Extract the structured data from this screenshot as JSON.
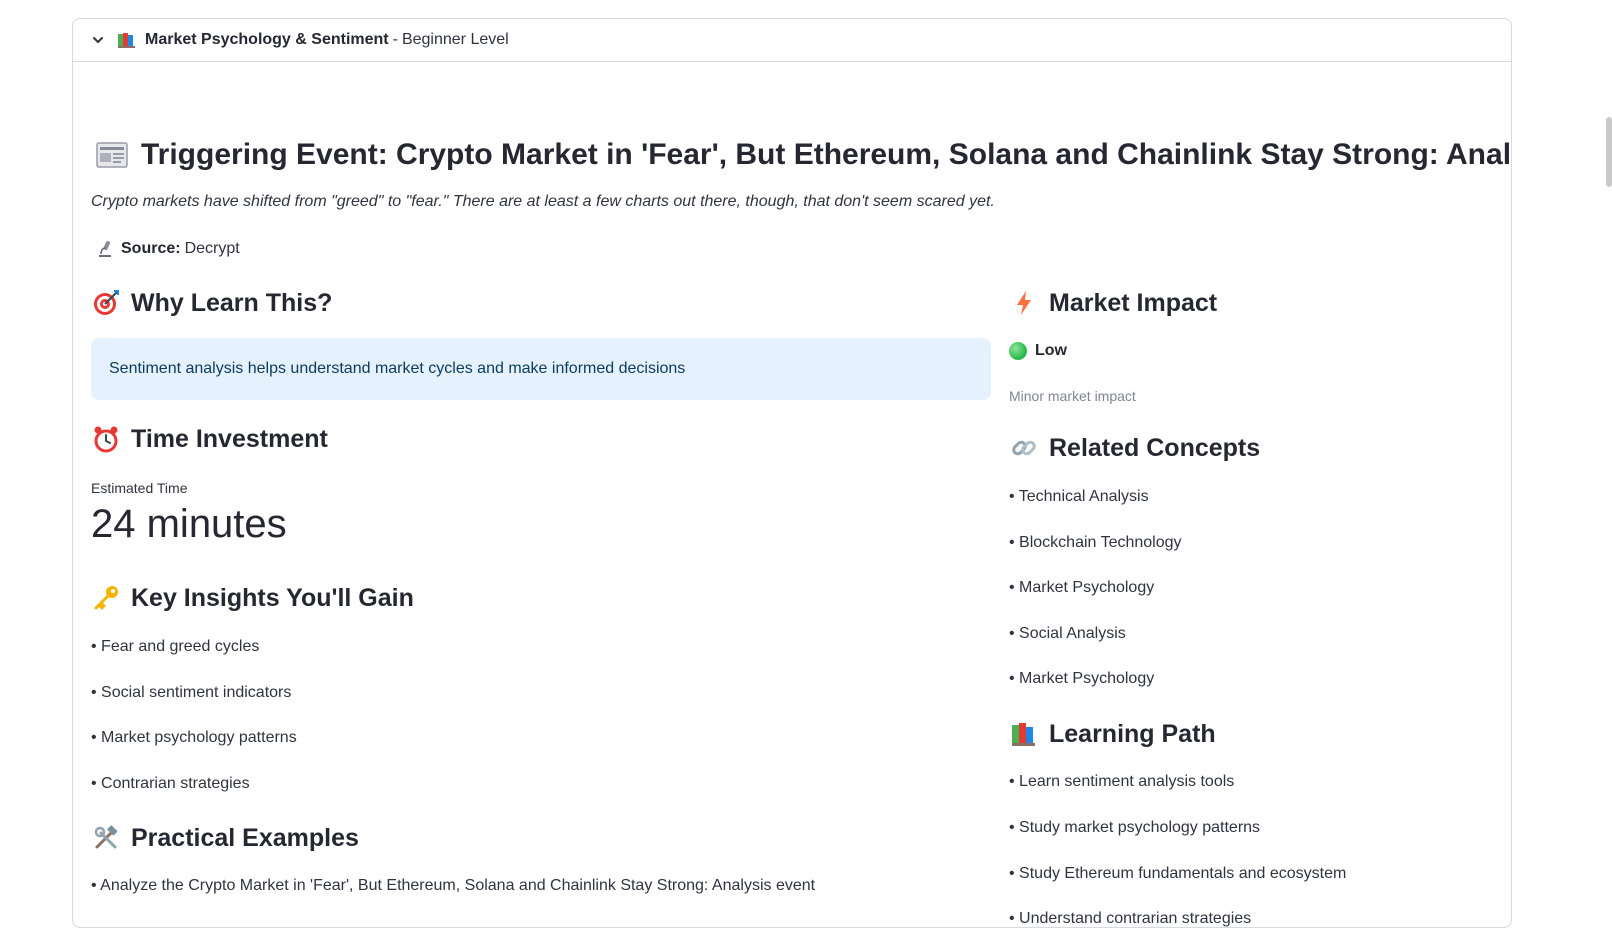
{
  "expander": {
    "title": "Market Psychology & Sentiment",
    "separator": "-",
    "level": "Beginner Level",
    "icon": "books-icon"
  },
  "event": {
    "heading": "Triggering Event: Crypto Market in 'Fear', But Ethereum, Solana and Chainlink Stay Strong: Analysis",
    "summary": "Crypto markets have shifted from \"greed\" to \"fear.\" There are at least a few charts out there, though, that don't seem scared yet.",
    "source_label": "Source:",
    "source_value": "Decrypt"
  },
  "why": {
    "heading": "Why Learn This?",
    "text": "Sentiment analysis helps understand market cycles and make informed decisions"
  },
  "time": {
    "heading": "Time Investment",
    "label": "Estimated Time",
    "value": "24 minutes"
  },
  "insights": {
    "heading": "Key Insights You'll Gain",
    "items": [
      "• Fear and greed cycles",
      "• Social sentiment indicators",
      "• Market psychology patterns",
      "• Contrarian strategies"
    ]
  },
  "examples": {
    "heading": "Practical Examples",
    "items": [
      "• Analyze the Crypto Market in 'Fear', But Ethereum, Solana and Chainlink Stay Strong: Analysis event"
    ]
  },
  "impact": {
    "heading": "Market Impact",
    "level": "Low",
    "caption": "Minor market impact"
  },
  "related": {
    "heading": "Related Concepts",
    "items": [
      "• Technical Analysis",
      "• Blockchain Technology",
      "• Market Psychology",
      "• Social Analysis",
      "• Market Psychology"
    ]
  },
  "path": {
    "heading": "Learning Path",
    "items": [
      "• Learn sentiment analysis tools",
      "• Study market psychology patterns",
      "• Study Ethereum fundamentals and ecosystem",
      "• Understand contrarian strategies"
    ]
  },
  "colors": {
    "info_bg": "#e5f1fc",
    "info_text": "#0d3c61",
    "impact_dot": "#2fbd4e"
  }
}
